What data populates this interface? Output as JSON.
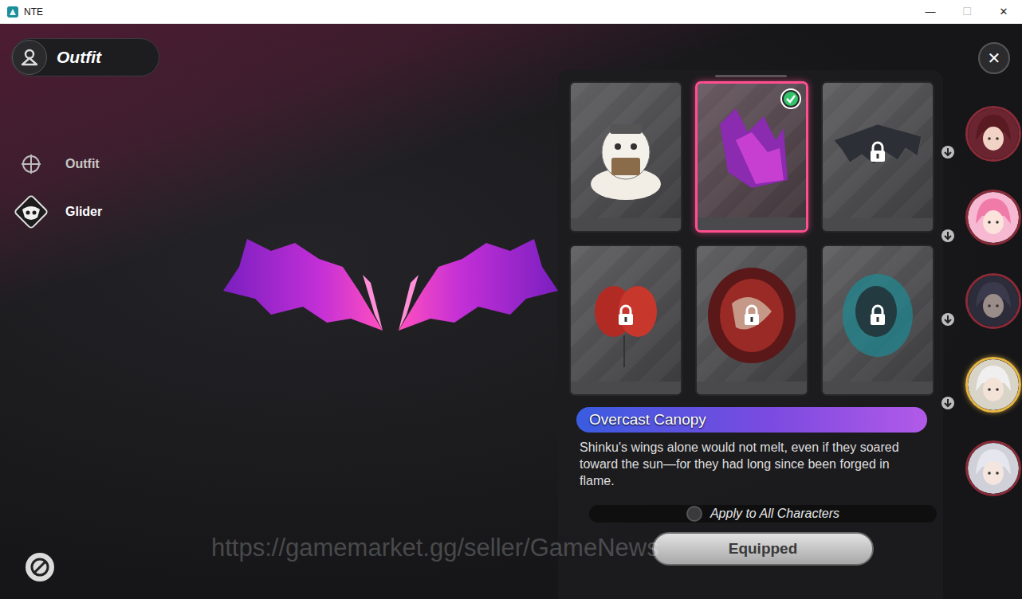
{
  "window": {
    "title": "NTE",
    "controls": [
      {
        "glyph": "—",
        "disabled": false
      },
      {
        "glyph": "☐",
        "disabled": true
      },
      {
        "glyph": "✕",
        "disabled": false
      }
    ]
  },
  "header": {
    "title": "Outfit"
  },
  "sidebar": {
    "items": [
      {
        "label": "Outfit",
        "selected": false
      },
      {
        "label": "Glider",
        "selected": true
      }
    ]
  },
  "gliders": [
    {
      "selected": false,
      "equipped": false,
      "locked": false
    },
    {
      "selected": true,
      "equipped": true,
      "locked": false
    },
    {
      "selected": false,
      "equipped": false,
      "locked": true
    },
    {
      "selected": false,
      "equipped": false,
      "locked": true
    },
    {
      "selected": false,
      "equipped": false,
      "locked": true
    },
    {
      "selected": false,
      "equipped": false,
      "locked": true
    }
  ],
  "detail": {
    "name": "Overcast Canopy",
    "description": "Shinku's wings alone would not melt, even if they soared toward the sun—for they had long since been forged in flame."
  },
  "apply_all": {
    "label": "Apply to All Characters",
    "on": false
  },
  "action_button": {
    "label": "Equipped",
    "disabled": true
  },
  "close_button": "✕",
  "characters": [
    {
      "selected": false,
      "download": true
    },
    {
      "selected": false,
      "download": true
    },
    {
      "selected": false,
      "download": true
    },
    {
      "selected": true,
      "download": true
    },
    {
      "selected": false,
      "download": false
    }
  ],
  "watermark": "https://gamemarket.gg/seller/GameNews"
}
